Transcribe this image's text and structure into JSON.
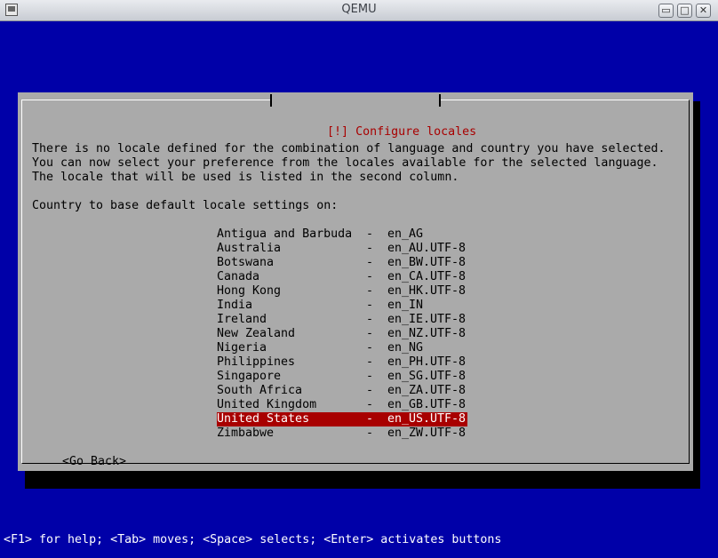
{
  "window": {
    "title": "QEMU",
    "minimize_symbol": "▭",
    "maximize_symbol": "□",
    "close_symbol": "✕"
  },
  "dialog": {
    "title": "[!] Configure locales",
    "description": [
      "There is no locale defined for the combination of language and country you have selected.",
      "You can now select your preference from the locales available for the selected language.",
      "The locale that will be used is listed in the second column."
    ],
    "prompt": "Country to base default locale settings on:",
    "separator": "-",
    "options": [
      {
        "country": "Antigua and Barbuda",
        "locale": "en_AG",
        "selected": false
      },
      {
        "country": "Australia",
        "locale": "en_AU.UTF-8",
        "selected": false
      },
      {
        "country": "Botswana",
        "locale": "en_BW.UTF-8",
        "selected": false
      },
      {
        "country": "Canada",
        "locale": "en_CA.UTF-8",
        "selected": false
      },
      {
        "country": "Hong Kong",
        "locale": "en_HK.UTF-8",
        "selected": false
      },
      {
        "country": "India",
        "locale": "en_IN",
        "selected": false
      },
      {
        "country": "Ireland",
        "locale": "en_IE.UTF-8",
        "selected": false
      },
      {
        "country": "New Zealand",
        "locale": "en_NZ.UTF-8",
        "selected": false
      },
      {
        "country": "Nigeria",
        "locale": "en_NG",
        "selected": false
      },
      {
        "country": "Philippines",
        "locale": "en_PH.UTF-8",
        "selected": false
      },
      {
        "country": "Singapore",
        "locale": "en_SG.UTF-8",
        "selected": false
      },
      {
        "country": "South Africa",
        "locale": "en_ZA.UTF-8",
        "selected": false
      },
      {
        "country": "United Kingdom",
        "locale": "en_GB.UTF-8",
        "selected": false
      },
      {
        "country": "United States",
        "locale": "en_US.UTF-8",
        "selected": true
      },
      {
        "country": "Zimbabwe",
        "locale": "en_ZW.UTF-8",
        "selected": false
      }
    ],
    "go_back_label": "<Go Back>"
  },
  "status_bar": {
    "text": "<F1> for help; <Tab> moves; <Space> selects; <Enter> activates buttons"
  },
  "colors": {
    "screen_background": "#0000a8",
    "dialog_background": "#aaaaaa",
    "title_text": "#a80000",
    "selection_background": "#a80000",
    "selection_text": "#ffffff"
  }
}
